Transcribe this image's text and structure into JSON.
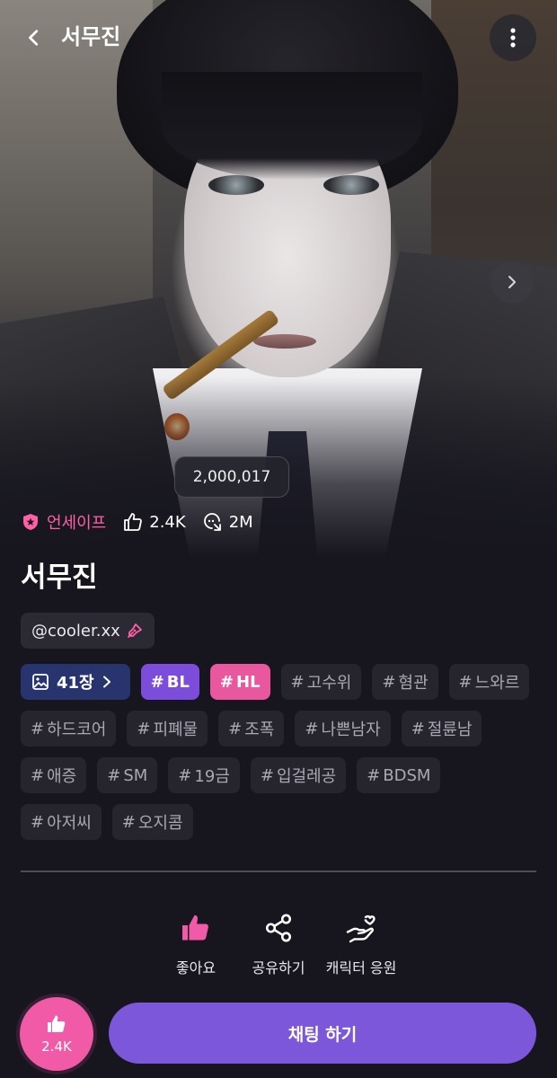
{
  "header": {
    "title": "서무진",
    "back_icon": "chevron-left-icon",
    "more_icon": "more-vertical-icon"
  },
  "hero": {
    "counter": "2,000,017",
    "next_icon": "chevron-right-icon"
  },
  "stats": {
    "rating_label": "언세이프",
    "likes": "2.4K",
    "chats": "2M",
    "rating_color": "#ff5fa6"
  },
  "profile": {
    "name": "서무진",
    "creator": "@cooler.xx"
  },
  "tags": {
    "images": "41장",
    "bl": "BL",
    "hl": "HL",
    "list": [
      "고수위",
      "혐관",
      "느와르",
      "하드코어",
      "피폐물",
      "조폭",
      "나쁜남자",
      "절륜남",
      "애증",
      "SM",
      "19금",
      "입걸레공",
      "BDSM",
      "아저씨",
      "오지콤"
    ]
  },
  "actions": {
    "like": "좋아요",
    "share": "공유하기",
    "support": "캐릭터 응원"
  },
  "bottom": {
    "like_count": "2.4K",
    "chat_button": "채팅 하기",
    "accent": "#7d57da",
    "like_color": "#f15aa6"
  }
}
